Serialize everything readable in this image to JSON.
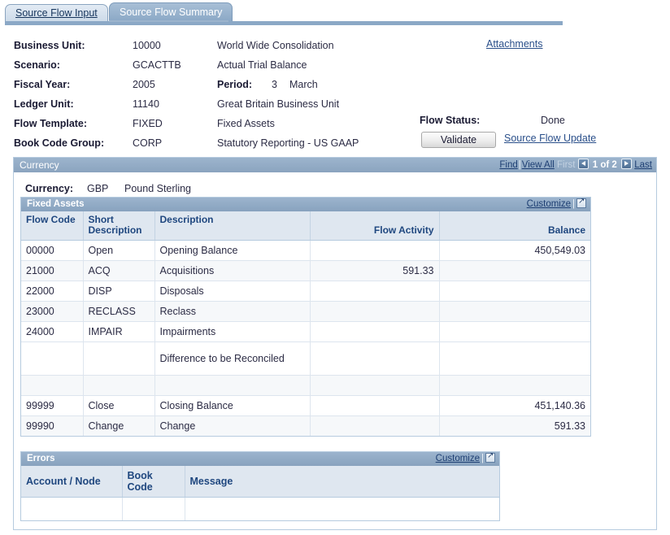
{
  "tabs": [
    {
      "label": "Source Flow Input",
      "active": false
    },
    {
      "label": "Source Flow Summary",
      "active": true
    }
  ],
  "header": {
    "fields": [
      {
        "label": "Business Unit:",
        "code": "10000",
        "description": "World Wide Consolidation"
      },
      {
        "label": "Scenario:",
        "code": "GCACTTB",
        "description": "Actual Trial Balance"
      },
      {
        "label": "Fiscal Year:",
        "code": "2005",
        "description": ""
      },
      {
        "label": "Ledger Unit:",
        "code": "11140",
        "description": "Great Britain Business Unit"
      },
      {
        "label": "Flow Template:",
        "code": "FIXED",
        "description": "Fixed Assets"
      },
      {
        "label": "Book Code Group:",
        "code": "CORP",
        "description": "Statutory Reporting - US GAAP"
      }
    ],
    "period_label": "Period:",
    "period_number": "3",
    "period_name": "March",
    "attachments_link": "Attachments",
    "flow_status_label": "Flow Status:",
    "flow_status_value": "Done",
    "validate_button": "Validate",
    "source_flow_update_link": "Source Flow Update"
  },
  "currency_group": {
    "title": "Currency",
    "nav": {
      "find": "Find",
      "separator": "|",
      "view_all": "View All",
      "first": "First",
      "counter": "1 of 2",
      "last": "Last"
    },
    "currency_label": "Currency:",
    "currency_code": "GBP",
    "currency_name": "Pound Sterling"
  },
  "fixed_assets_grid": {
    "title": "Fixed Assets",
    "customize_link": "Customize",
    "separator": "|",
    "columns": [
      {
        "label": "Flow Code",
        "align": "left"
      },
      {
        "label": "Short Description",
        "align": "left"
      },
      {
        "label": "Description",
        "align": "left"
      },
      {
        "label": "Flow Activity",
        "align": "right"
      },
      {
        "label": "Balance",
        "align": "right"
      }
    ],
    "rows": [
      {
        "flow_code": "00000",
        "short_description": "Open",
        "description": "Opening Balance",
        "flow_activity": "",
        "balance": "450,549.03",
        "height": "normal"
      },
      {
        "flow_code": "21000",
        "short_description": "ACQ",
        "description": "Acquisitions",
        "flow_activity": "591.33",
        "balance": "",
        "height": "normal"
      },
      {
        "flow_code": "22000",
        "short_description": "DISP",
        "description": "Disposals",
        "flow_activity": "",
        "balance": "",
        "height": "normal"
      },
      {
        "flow_code": "23000",
        "short_description": "RECLASS",
        "description": "Reclass",
        "flow_activity": "",
        "balance": "",
        "height": "normal"
      },
      {
        "flow_code": "24000",
        "short_description": "IMPAIR",
        "description": "Impairments",
        "flow_activity": "",
        "balance": "",
        "height": "normal"
      },
      {
        "flow_code": "",
        "short_description": "",
        "description": "Difference to be Reconciled",
        "flow_activity": "",
        "balance": "",
        "height": "tall"
      },
      {
        "flow_code": "",
        "short_description": "",
        "description": "",
        "flow_activity": "",
        "balance": "",
        "height": "short"
      },
      {
        "flow_code": "99999",
        "short_description": "Close",
        "description": "Closing Balance",
        "flow_activity": "",
        "balance": "451,140.36",
        "height": "normal"
      },
      {
        "flow_code": "99990",
        "short_description": "Change",
        "description": "Change",
        "flow_activity": "",
        "balance": "591.33",
        "height": "normal"
      }
    ]
  },
  "errors_grid": {
    "title": "Errors",
    "customize_link": "Customize",
    "separator": "|",
    "columns": [
      {
        "label": "Account / Node"
      },
      {
        "label": "Book Code"
      },
      {
        "label": "Message"
      }
    ],
    "rows": []
  },
  "colors": {
    "tab_active": "#8ba8c6",
    "header_bar": "#9cb4cd",
    "column_header": "#dfe7f0",
    "link": "#2a4f8a",
    "row_alt": "#f6f8fa"
  }
}
